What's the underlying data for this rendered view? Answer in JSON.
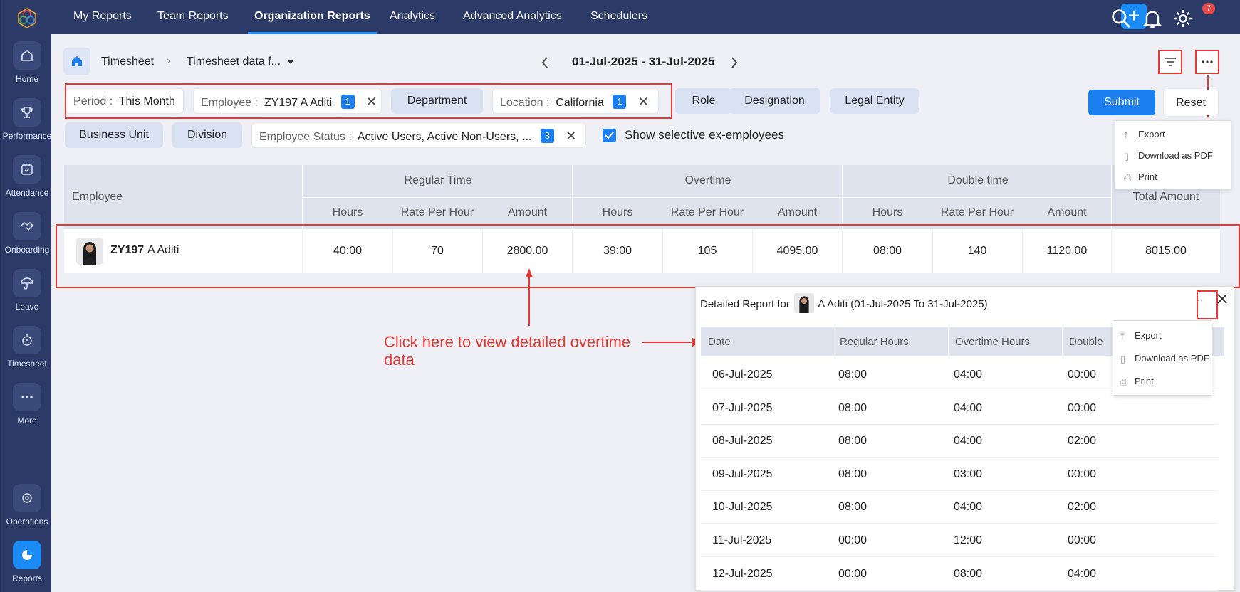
{
  "nav": {
    "tabs": [
      {
        "label": "My Reports"
      },
      {
        "label": "Team Reports"
      },
      {
        "label": "Organization Reports"
      },
      {
        "label": "Analytics"
      },
      {
        "label": "Advanced Analytics"
      },
      {
        "label": "Schedulers"
      }
    ],
    "notification_count": "7"
  },
  "sidebar": {
    "items": [
      {
        "label": "Home",
        "icon": "home-icon"
      },
      {
        "label": "Performance",
        "icon": "trophy-icon"
      },
      {
        "label": "Attendance",
        "icon": "calendar-check-icon"
      },
      {
        "label": "Onboarding",
        "icon": "handshake-icon"
      },
      {
        "label": "Leave",
        "icon": "umbrella-icon"
      },
      {
        "label": "Timesheet",
        "icon": "timer-icon"
      },
      {
        "label": "More",
        "icon": "more-icon"
      },
      {
        "label": "Operations",
        "icon": "operations-icon"
      },
      {
        "label": "Reports",
        "icon": "pie-chart-icon"
      }
    ]
  },
  "breadcrumb": {
    "root": "Timesheet",
    "current": "Timesheet data f..."
  },
  "period_nav": {
    "range": "01-Jul-2025 - 31-Jul-2025"
  },
  "filters": {
    "period": {
      "key": "Period :",
      "value": "This Month"
    },
    "employee": {
      "key": "Employee :",
      "value": "ZY197 A Aditi",
      "count": "1"
    },
    "department": "Department",
    "location": {
      "key": "Location :",
      "value": "California",
      "count": "1"
    },
    "role": "Role",
    "designation": "Designation",
    "legal_entity": "Legal Entity",
    "business_unit": "Business Unit",
    "division": "Division",
    "employee_status": {
      "key": "Employee Status :",
      "value": "Active Users, Active Non-Users, ...",
      "count": "3"
    },
    "ex_employees_label": "Show selective ex-employees",
    "submit": "Submit",
    "reset": "Reset"
  },
  "export_menu": {
    "items": [
      "Export",
      "Download as PDF",
      "Print"
    ]
  },
  "table": {
    "employee_header": "Employee",
    "groups": [
      "Regular Time",
      "Overtime",
      "Double time"
    ],
    "sub_headers": [
      "Hours",
      "Rate Per Hour",
      "Amount"
    ],
    "total_header": "Total Amount",
    "row": {
      "emp_id": "ZY197",
      "emp_name": "A Aditi",
      "values": [
        "40:00",
        "70",
        "2800.00",
        "39:00",
        "105",
        "4095.00",
        "08:00",
        "140",
        "1120.00",
        "8015.00"
      ]
    }
  },
  "annotation": {
    "text": "Click here to view detailed overtime data"
  },
  "detail": {
    "title_prefix": "Detailed Report for",
    "title_suffix": "A Aditi (01-Jul-2025 To 31-Jul-2025)",
    "headers": [
      "Date",
      "Regular Hours",
      "Overtime Hours",
      "Double"
    ],
    "rows": [
      [
        "06-Jul-2025",
        "08:00",
        "04:00",
        "00:00"
      ],
      [
        "07-Jul-2025",
        "08:00",
        "04:00",
        "00:00"
      ],
      [
        "08-Jul-2025",
        "08:00",
        "04:00",
        "02:00"
      ],
      [
        "09-Jul-2025",
        "08:00",
        "03:00",
        "00:00"
      ],
      [
        "10-Jul-2025",
        "08:00",
        "04:00",
        "02:00"
      ],
      [
        "11-Jul-2025",
        "00:00",
        "12:00",
        "00:00"
      ],
      [
        "12-Jul-2025",
        "00:00",
        "08:00",
        "04:00"
      ]
    ],
    "menu": [
      "Export",
      "Download as PDF",
      "Print"
    ]
  },
  "colors": {
    "nav_bg": "#2b3a67",
    "accent": "#1b7ff0",
    "annotation": "#e53935"
  }
}
